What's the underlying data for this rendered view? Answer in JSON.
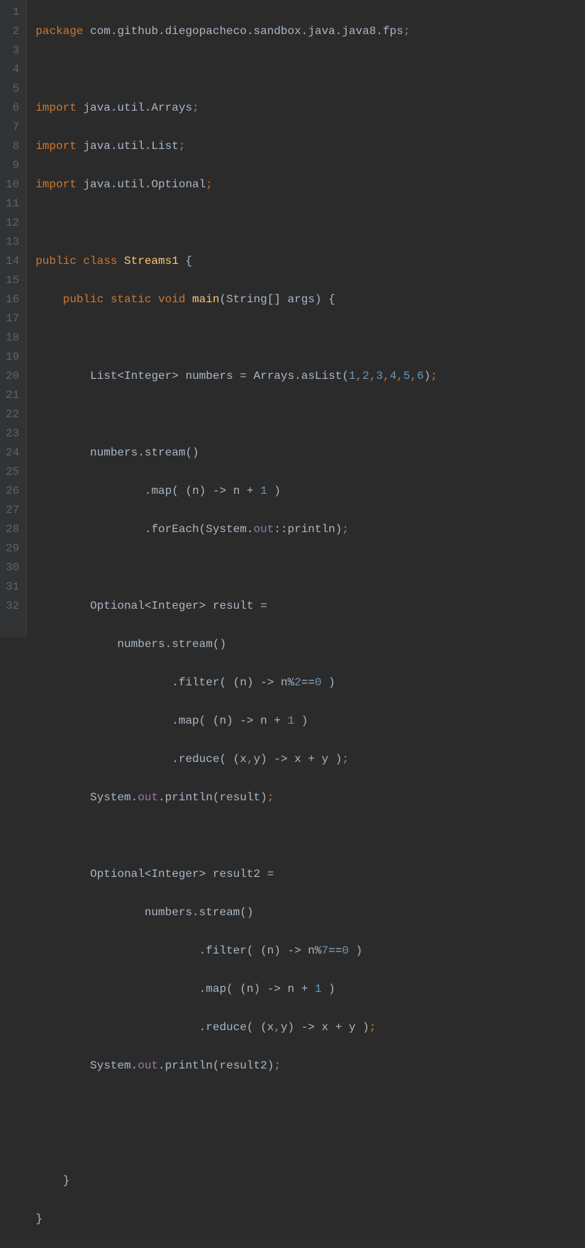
{
  "gutter": {
    "lines": [
      "1",
      "2",
      "3",
      "4",
      "5",
      "6",
      "7",
      "8",
      "9",
      "10",
      "11",
      "12",
      "13",
      "14",
      "15",
      "16",
      "17",
      "18",
      "19",
      "20",
      "21",
      "22",
      "23",
      "24",
      "25",
      "26",
      "27",
      "28",
      "29",
      "30",
      "31",
      "32"
    ]
  },
  "code": {
    "l1": {
      "kw1": "package",
      "pkg": " com.github.diegopacheco.sandbox.java.java8.fps",
      "semi": ";"
    },
    "l3": {
      "kw": "import",
      "pkg": " java.util.Arrays",
      "semi": ";"
    },
    "l4": {
      "kw": "import",
      "pkg": " java.util.List",
      "semi": ";"
    },
    "l5": {
      "kw": "import",
      "pkg": " java.util.Optional",
      "semi": ";"
    },
    "l7": {
      "kw1": "public",
      "kw2": " class",
      "cls": " Streams1",
      "brace": " {"
    },
    "l8": {
      "kw1": "public",
      "kw2": " static",
      "kw3": " void",
      "meth": " main",
      "p1": "(",
      "t": "String",
      "br": "[] ",
      "arg": "args",
      "p2": ")",
      "brace": " {"
    },
    "l10": {
      "t1": "List",
      "lt": "<",
      "t2": "Integer",
      "gt": ">",
      "var": " numbers ",
      "eq": "=",
      "sp": " ",
      "cls": "Arrays",
      "dot": ".",
      "m": "asList",
      "p1": "(",
      "n1": "1",
      "c1": ",",
      "n2": "2",
      "c2": ",",
      "n3": "3",
      "c3": ",",
      "n4": "4",
      "c4": ",",
      "n5": "5",
      "c5": ",",
      "n6": "6",
      "p2": ")",
      "semi": ";"
    },
    "l12": {
      "var": "numbers",
      "dot": ".",
      "m": "stream",
      "p": "()"
    },
    "l13": {
      "dot": ".",
      "m": "map",
      "p1": "( (",
      "arg": "n",
      "p2": ") ",
      "arrow": "->",
      "sp": " ",
      "v": "n ",
      "op": "+",
      "num": " 1",
      "p3": " )"
    },
    "l14": {
      "dot": ".",
      "m": "forEach",
      "p1": "(",
      "cls": "System",
      "dot2": ".",
      "f": "out",
      "cc": "::",
      "m2": "println",
      "p2": ")",
      "semi": ";"
    },
    "l16": {
      "t1": "Optional",
      "lt": "<",
      "t2": "Integer",
      "gt": ">",
      "var": " result ",
      "eq": "="
    },
    "l17": {
      "var": "numbers",
      "dot": ".",
      "m": "stream",
      "p": "()"
    },
    "l18": {
      "dot": ".",
      "m": "filter",
      "p1": "( (",
      "arg": "n",
      "p2": ") ",
      "arrow": "->",
      "sp": " ",
      "v": "n",
      "op": "%",
      "n2": "2",
      "eq": "==",
      "n0": "0",
      "p3": " )"
    },
    "l19": {
      "dot": ".",
      "m": "map",
      "p1": "( (",
      "arg": "n",
      "p2": ") ",
      "arrow": "->",
      "sp": " ",
      "v": "n ",
      "op": "+",
      "num": " 1",
      "p3": " )"
    },
    "l20": {
      "dot": ".",
      "m": "reduce",
      "p1": "( (",
      "a1": "x",
      "cm": ",",
      "a2": "y",
      "p2": ") ",
      "arrow": "->",
      "sp": " ",
      "v1": "x ",
      "op": "+",
      "v2": " y ",
      "p3": ")",
      "semi": ";"
    },
    "l21": {
      "cls": "System",
      "dot": ".",
      "f": "out",
      "dot2": ".",
      "m": "println",
      "p1": "(",
      "arg": "result",
      "p2": ")",
      "semi": ";"
    },
    "l23": {
      "t1": "Optional",
      "lt": "<",
      "t2": "Integer",
      "gt": ">",
      "var": " result2 ",
      "eq": "="
    },
    "l24": {
      "var": "numbers",
      "dot": ".",
      "m": "stream",
      "p": "()"
    },
    "l25": {
      "dot": ".",
      "m": "filter",
      "p1": "( (",
      "arg": "n",
      "p2": ") ",
      "arrow": "->",
      "sp": " ",
      "v": "n",
      "op": "%",
      "n7": "7",
      "eq": "==",
      "n0": "0",
      "p3": " )"
    },
    "l26": {
      "dot": ".",
      "m": "map",
      "p1": "( (",
      "arg": "n",
      "p2": ") ",
      "arrow": "->",
      "sp": " ",
      "v": "n ",
      "op": "+",
      "num": " 1",
      "p3": " )"
    },
    "l27": {
      "dot": ".",
      "m": "reduce",
      "p1": "( (",
      "a1": "x",
      "cm": ",",
      "a2": "y",
      "p2": ") ",
      "arrow": "->",
      "sp": " ",
      "v1": "x ",
      "op": "+",
      "v2": " y ",
      "p3": ")",
      "semi": ";"
    },
    "l28": {
      "cls": "System",
      "dot": ".",
      "f": "out",
      "dot2": ".",
      "m": "println",
      "p1": "(",
      "arg": "result2",
      "p2": ")",
      "semi": ";"
    },
    "l31": {
      "brace": "}"
    },
    "l32": {
      "brace": "}"
    }
  },
  "indent": {
    "i1": "    ",
    "i2": "        ",
    "i3": "            ",
    "i4": "                ",
    "i5": "                    ",
    "i6": "                        ",
    "i7": "                            "
  }
}
